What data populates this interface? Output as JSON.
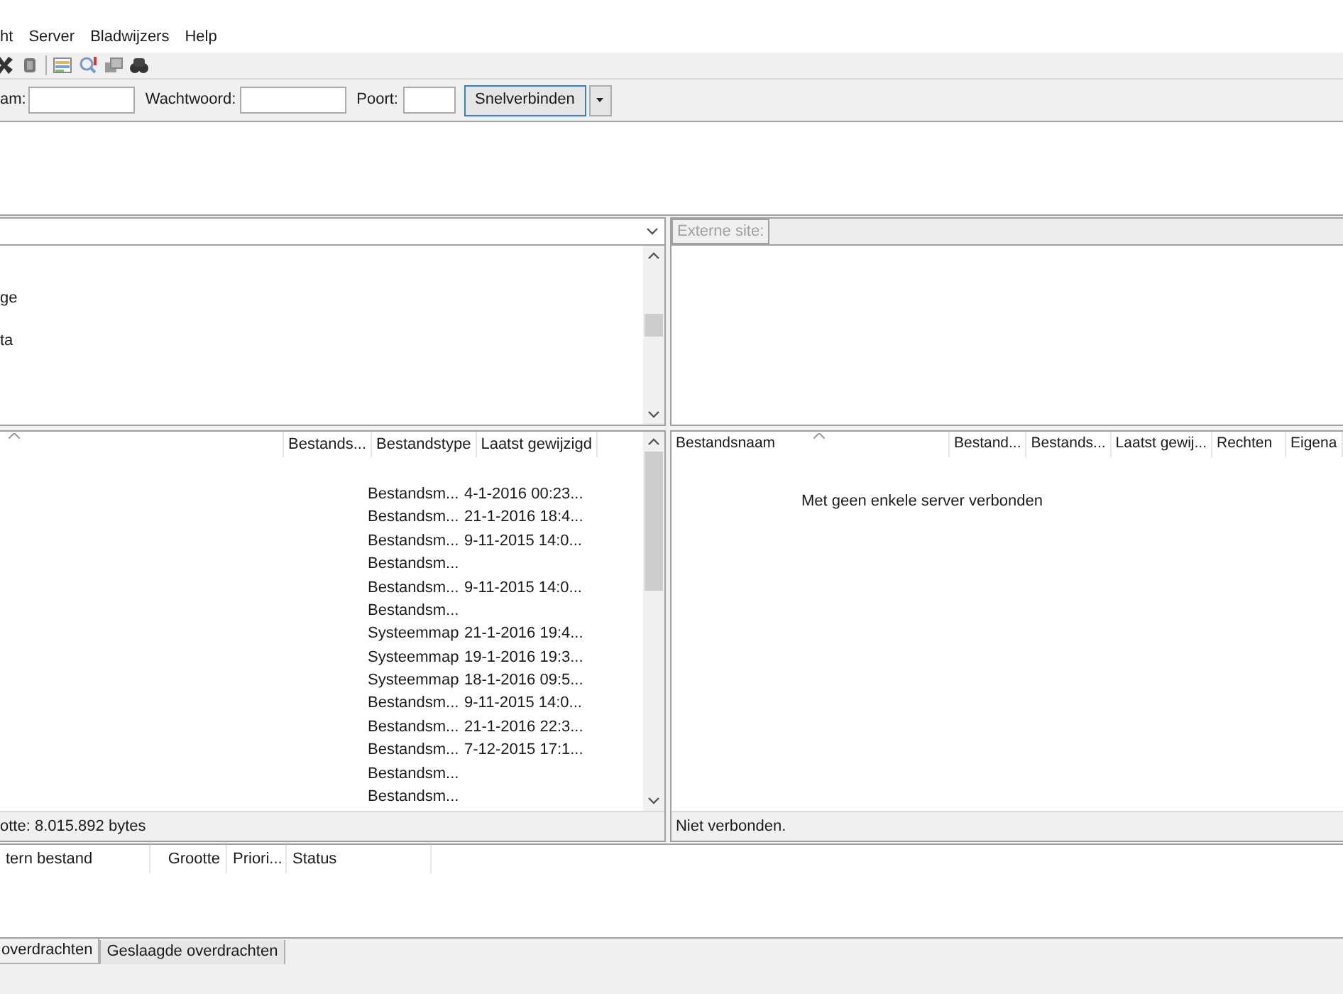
{
  "menu": [
    {
      "label": "ht"
    },
    {
      "label": "Server"
    },
    {
      "label": "Bladwijzers"
    },
    {
      "label": "Help"
    }
  ],
  "quickconnect": {
    "fields": [
      {
        "label": "am:"
      },
      {
        "label": "Wachtwoord:"
      },
      {
        "label": "Poort:"
      }
    ],
    "button": "Snelverbinden"
  },
  "local": {
    "tree": [
      {
        "label": "ge"
      },
      {
        "label": "ta"
      }
    ],
    "columns": [
      {
        "label": "Bestands..."
      },
      {
        "label": "Bestandstype"
      },
      {
        "label": "Laatst gewijzigd"
      }
    ],
    "rows": [
      {
        "type": "Bestandsm...",
        "modified": "4-1-2016 00:23..."
      },
      {
        "type": "Bestandsm...",
        "modified": "21-1-2016 18:4..."
      },
      {
        "type": "Bestandsm...",
        "modified": "9-11-2015 14:0..."
      },
      {
        "type": "Bestandsm..."
      },
      {
        "type": "Bestandsm...",
        "modified": "9-11-2015 14:0..."
      },
      {
        "type": "Bestandsm..."
      },
      {
        "type": "Systeemmap",
        "modified": "21-1-2016 19:4..."
      },
      {
        "type": "Systeemmap",
        "modified": "19-1-2016 19:3..."
      },
      {
        "type": "Systeemmap",
        "modified": "18-1-2016 09:5..."
      },
      {
        "type": "Bestandsm...",
        "modified": "9-11-2015 14:0..."
      },
      {
        "type": "Bestandsm...",
        "modified": "21-1-2016 22:3..."
      },
      {
        "type": "Bestandsm...",
        "modified": "7-12-2015 17:1..."
      },
      {
        "type": "Bestandsm..."
      },
      {
        "type": "Bestandsm..."
      }
    ],
    "status": "otte: 8.015.892 bytes"
  },
  "remote": {
    "site_label": "Externe site:",
    "columns": [
      {
        "label": "Bestandsnaam"
      },
      {
        "label": "Bestand..."
      },
      {
        "label": "Bestands..."
      },
      {
        "label": "Laatst gewij..."
      },
      {
        "label": "Rechten"
      },
      {
        "label": "Eigena"
      }
    ],
    "message": "Met geen enkele server verbonden",
    "status": "Niet verbonden."
  },
  "queue": {
    "columns": [
      {
        "label": "tern bestand"
      },
      {
        "label": "Grootte"
      },
      {
        "label": "Priori..."
      },
      {
        "label": "Status"
      }
    ]
  },
  "tabs": [
    {
      "label": "overdrachten",
      "selected": true
    },
    {
      "label": "Geslaagde overdrachten",
      "selected": false
    }
  ]
}
